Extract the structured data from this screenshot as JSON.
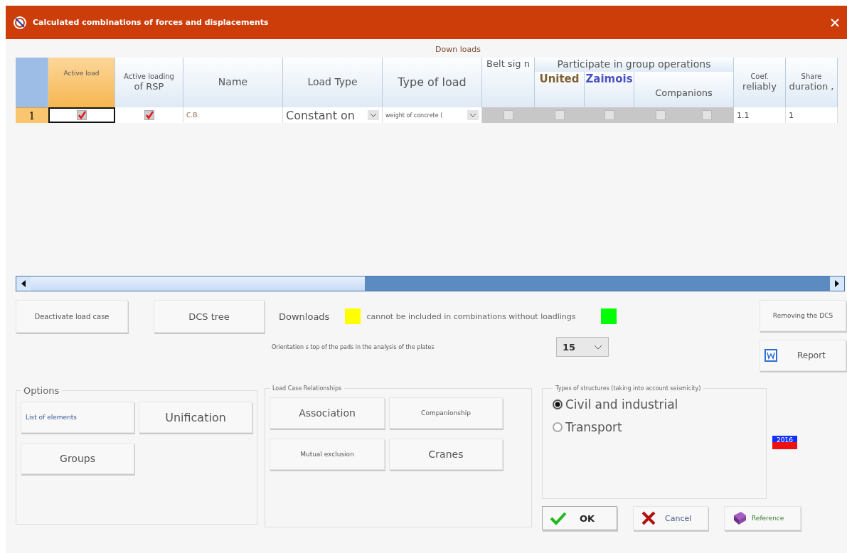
{
  "window": {
    "title": "Calculated combinations of forces and displacements"
  },
  "table": {
    "caption": "Down loads",
    "columns": [
      {
        "label": "Active load",
        "selected": true
      },
      {
        "label": "Active loading",
        "sublabel": "of RSP",
        "selected": false
      },
      {
        "label": "Name",
        "selected": false
      },
      {
        "label": "Load Type",
        "selected": false
      },
      {
        "label": "Type of load",
        "selected": false
      },
      {
        "label": "Belt sig n",
        "selected": false
      },
      {
        "label": "Participate in group operations",
        "children": [
          {
            "label": "United",
            "selected": false
          },
          {
            "label": "Zaimois",
            "selected": false
          },
          {
            "label": "Companions",
            "selected": false
          }
        ]
      },
      {
        "label": "Coef.",
        "sublabel": "reliably",
        "selected": false
      },
      {
        "label": "Share",
        "sublabel": "duration ,",
        "selected": false
      }
    ],
    "rows": [
      {
        "number": "1",
        "selected": true,
        "cells": [
          {
            "kind": "check",
            "checked": true,
            "focused": true,
            "disabled": false
          },
          {
            "kind": "check",
            "checked": true,
            "focused": false,
            "disabled": false
          },
          {
            "kind": "text",
            "value": "C.B.",
            "focused": false,
            "disabled": false
          },
          {
            "kind": "select",
            "value": "Constant on",
            "focused": false,
            "disabled": false
          },
          {
            "kind": "select",
            "value": "weight of concrete (",
            "focused": false,
            "disabled": false
          },
          {
            "kind": "check",
            "checked": false,
            "focused": false,
            "disabled": true
          },
          {
            "kind": "check",
            "checked": false,
            "focused": false,
            "disabled": true
          },
          {
            "kind": "check",
            "checked": false,
            "focused": false,
            "disabled": true
          },
          {
            "kind": "checks",
            "items": [
              {
                "checked": false
              },
              {
                "checked": false
              }
            ],
            "focused": false,
            "disabled": true
          },
          {
            "kind": "text",
            "value": "1.1",
            "focused": false,
            "disabled": false
          },
          {
            "kind": "text",
            "value": "1",
            "focused": false,
            "disabled": false
          }
        ]
      }
    ]
  },
  "actions": {
    "deactivate": "Deactivate load case",
    "tree": "DCS tree",
    "remove": "Removing the DCS",
    "report": "Report"
  },
  "legend": {
    "label": "Downloads",
    "items": [
      {
        "text": "cannot be included  in combinations without loadlings",
        "color": "#ffff00"
      },
      {
        "color": "#00ff00"
      }
    ]
  },
  "orientation": {
    "label": "Orientation s top of the pads in the analysis of the plates",
    "value": "15"
  },
  "options": {
    "title": "Options",
    "buttons": [
      "List of elements",
      "Unification",
      "Groups"
    ]
  },
  "relationships": {
    "title": "Load Case Relationships",
    "buttons": [
      "Association",
      "Companionship",
      "Mutual exclusion",
      "Cranes"
    ]
  },
  "structures": {
    "title": "Types of structures (taking into account seismicity)",
    "choices": [
      {
        "label": "Civil and industrial",
        "selected": true
      },
      {
        "label": "Transport",
        "selected": false
      }
    ]
  },
  "badge": "2016",
  "buttons": [
    {
      "kind": "ok",
      "label": "OK"
    },
    {
      "kind": "cancel",
      "label": "Cancel"
    },
    {
      "kind": "reference",
      "label": "Reference"
    }
  ]
}
